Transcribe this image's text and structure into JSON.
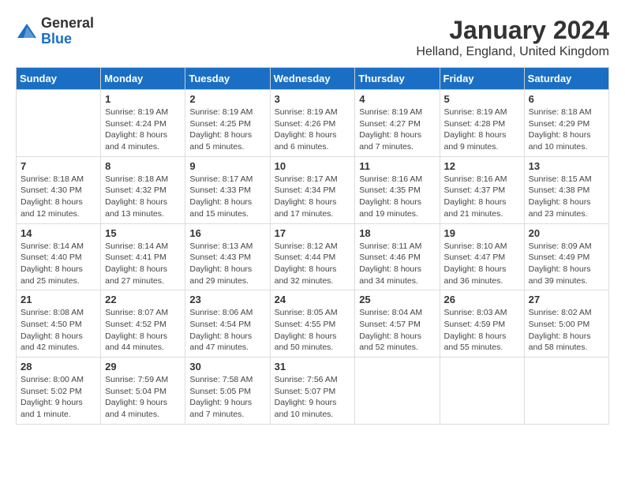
{
  "logo": {
    "general": "General",
    "blue": "Blue"
  },
  "title": "January 2024",
  "location": "Helland, England, United Kingdom",
  "weekdays": [
    "Sunday",
    "Monday",
    "Tuesday",
    "Wednesday",
    "Thursday",
    "Friday",
    "Saturday"
  ],
  "weeks": [
    [
      {
        "day": "",
        "info": ""
      },
      {
        "day": "1",
        "info": "Sunrise: 8:19 AM\nSunset: 4:24 PM\nDaylight: 8 hours\nand 4 minutes."
      },
      {
        "day": "2",
        "info": "Sunrise: 8:19 AM\nSunset: 4:25 PM\nDaylight: 8 hours\nand 5 minutes."
      },
      {
        "day": "3",
        "info": "Sunrise: 8:19 AM\nSunset: 4:26 PM\nDaylight: 8 hours\nand 6 minutes."
      },
      {
        "day": "4",
        "info": "Sunrise: 8:19 AM\nSunset: 4:27 PM\nDaylight: 8 hours\nand 7 minutes."
      },
      {
        "day": "5",
        "info": "Sunrise: 8:19 AM\nSunset: 4:28 PM\nDaylight: 8 hours\nand 9 minutes."
      },
      {
        "day": "6",
        "info": "Sunrise: 8:18 AM\nSunset: 4:29 PM\nDaylight: 8 hours\nand 10 minutes."
      }
    ],
    [
      {
        "day": "7",
        "info": "Sunrise: 8:18 AM\nSunset: 4:30 PM\nDaylight: 8 hours\nand 12 minutes."
      },
      {
        "day": "8",
        "info": "Sunrise: 8:18 AM\nSunset: 4:32 PM\nDaylight: 8 hours\nand 13 minutes."
      },
      {
        "day": "9",
        "info": "Sunrise: 8:17 AM\nSunset: 4:33 PM\nDaylight: 8 hours\nand 15 minutes."
      },
      {
        "day": "10",
        "info": "Sunrise: 8:17 AM\nSunset: 4:34 PM\nDaylight: 8 hours\nand 17 minutes."
      },
      {
        "day": "11",
        "info": "Sunrise: 8:16 AM\nSunset: 4:35 PM\nDaylight: 8 hours\nand 19 minutes."
      },
      {
        "day": "12",
        "info": "Sunrise: 8:16 AM\nSunset: 4:37 PM\nDaylight: 8 hours\nand 21 minutes."
      },
      {
        "day": "13",
        "info": "Sunrise: 8:15 AM\nSunset: 4:38 PM\nDaylight: 8 hours\nand 23 minutes."
      }
    ],
    [
      {
        "day": "14",
        "info": "Sunrise: 8:14 AM\nSunset: 4:40 PM\nDaylight: 8 hours\nand 25 minutes."
      },
      {
        "day": "15",
        "info": "Sunrise: 8:14 AM\nSunset: 4:41 PM\nDaylight: 8 hours\nand 27 minutes."
      },
      {
        "day": "16",
        "info": "Sunrise: 8:13 AM\nSunset: 4:43 PM\nDaylight: 8 hours\nand 29 minutes."
      },
      {
        "day": "17",
        "info": "Sunrise: 8:12 AM\nSunset: 4:44 PM\nDaylight: 8 hours\nand 32 minutes."
      },
      {
        "day": "18",
        "info": "Sunrise: 8:11 AM\nSunset: 4:46 PM\nDaylight: 8 hours\nand 34 minutes."
      },
      {
        "day": "19",
        "info": "Sunrise: 8:10 AM\nSunset: 4:47 PM\nDaylight: 8 hours\nand 36 minutes."
      },
      {
        "day": "20",
        "info": "Sunrise: 8:09 AM\nSunset: 4:49 PM\nDaylight: 8 hours\nand 39 minutes."
      }
    ],
    [
      {
        "day": "21",
        "info": "Sunrise: 8:08 AM\nSunset: 4:50 PM\nDaylight: 8 hours\nand 42 minutes."
      },
      {
        "day": "22",
        "info": "Sunrise: 8:07 AM\nSunset: 4:52 PM\nDaylight: 8 hours\nand 44 minutes."
      },
      {
        "day": "23",
        "info": "Sunrise: 8:06 AM\nSunset: 4:54 PM\nDaylight: 8 hours\nand 47 minutes."
      },
      {
        "day": "24",
        "info": "Sunrise: 8:05 AM\nSunset: 4:55 PM\nDaylight: 8 hours\nand 50 minutes."
      },
      {
        "day": "25",
        "info": "Sunrise: 8:04 AM\nSunset: 4:57 PM\nDaylight: 8 hours\nand 52 minutes."
      },
      {
        "day": "26",
        "info": "Sunrise: 8:03 AM\nSunset: 4:59 PM\nDaylight: 8 hours\nand 55 minutes."
      },
      {
        "day": "27",
        "info": "Sunrise: 8:02 AM\nSunset: 5:00 PM\nDaylight: 8 hours\nand 58 minutes."
      }
    ],
    [
      {
        "day": "28",
        "info": "Sunrise: 8:00 AM\nSunset: 5:02 PM\nDaylight: 9 hours\nand 1 minute."
      },
      {
        "day": "29",
        "info": "Sunrise: 7:59 AM\nSunset: 5:04 PM\nDaylight: 9 hours\nand 4 minutes."
      },
      {
        "day": "30",
        "info": "Sunrise: 7:58 AM\nSunset: 5:05 PM\nDaylight: 9 hours\nand 7 minutes."
      },
      {
        "day": "31",
        "info": "Sunrise: 7:56 AM\nSunset: 5:07 PM\nDaylight: 9 hours\nand 10 minutes."
      },
      {
        "day": "",
        "info": ""
      },
      {
        "day": "",
        "info": ""
      },
      {
        "day": "",
        "info": ""
      }
    ]
  ]
}
